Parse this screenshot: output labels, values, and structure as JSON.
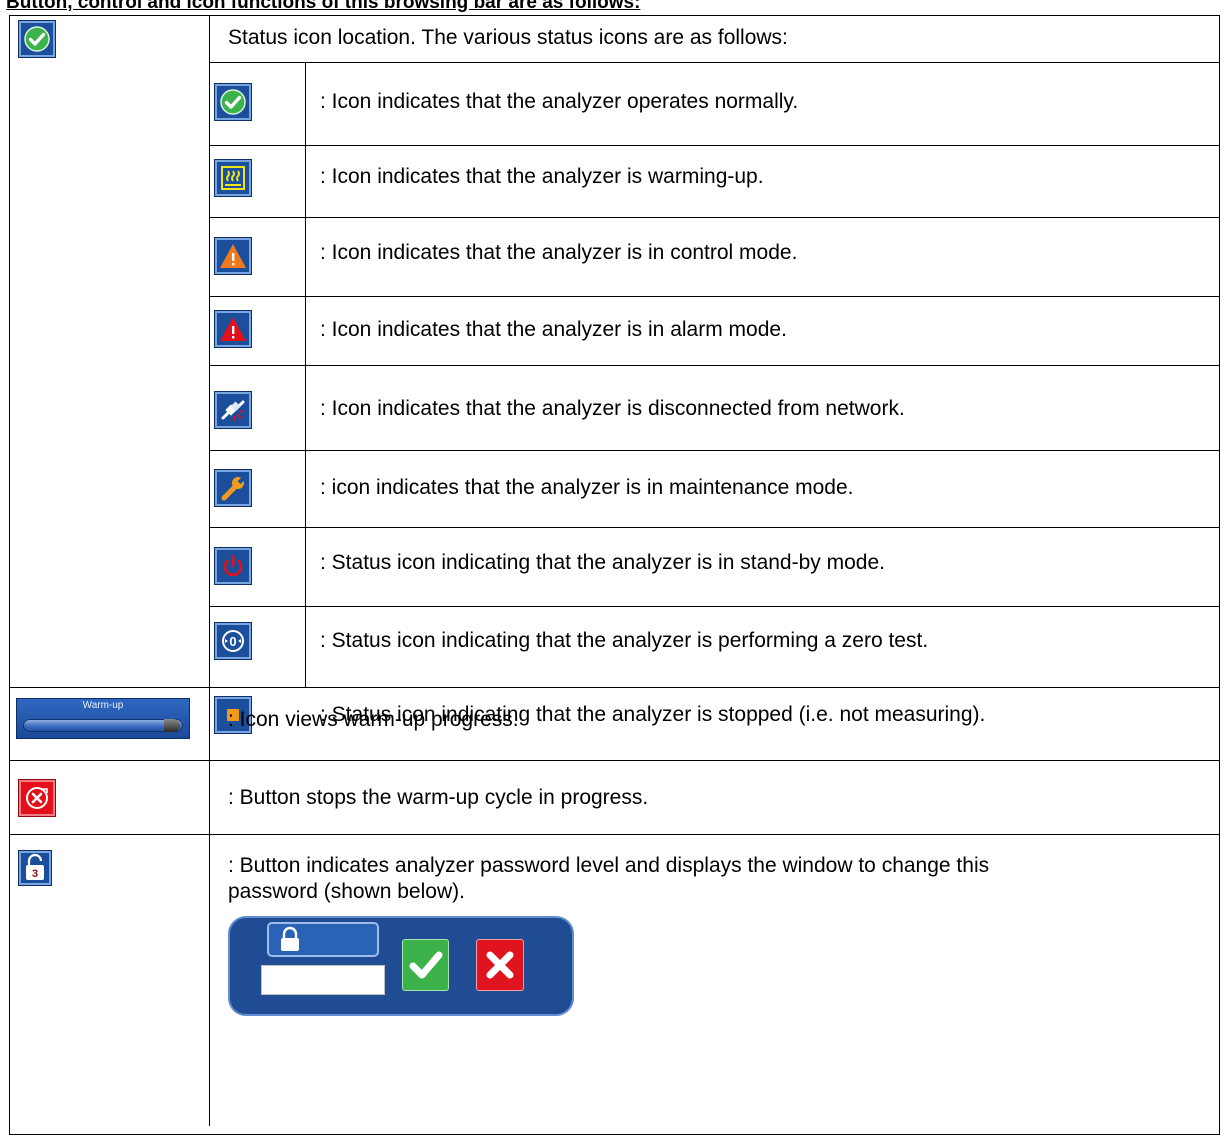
{
  "heading": "Button, control and icon functions of this browsing bar are as follows:",
  "status_intro": "Status icon location. The various status icons are as follows:",
  "status_rows": [
    {
      "icon": "check-circle-icon",
      "text": ": Icon indicates that the analyzer operates normally."
    },
    {
      "icon": "heat-waves-icon",
      "text": ": Icon indicates that the analyzer is warming-up."
    },
    {
      "icon": "orange-warning-triangle-icon",
      "text": ": Icon indicates that the analyzer is in control mode."
    },
    {
      "icon": "red-warning-triangle-icon",
      "text": ": Icon indicates that the analyzer is in alarm mode."
    },
    {
      "icon": "disconnected-plug-icon",
      "text": ": Icon indicates that the analyzer is disconnected from network."
    },
    {
      "icon": "wrench-icon",
      "text": ": icon indicates that the analyzer is in maintenance mode."
    },
    {
      "icon": "power-icon",
      "text": ": Status icon indicating that the analyzer is in stand-by mode."
    },
    {
      "icon": "zero-test-icon",
      "text": ": Status icon indicating that the analyzer is performing a zero test."
    },
    {
      "icon": "stop-square-icon",
      "text": ": Status icon indicating that the analyzer is stopped (i.e. not measuring)."
    }
  ],
  "warmup": {
    "label": "Warm-up",
    "text": ": Icon views warm-up progress.",
    "progress_fraction": 0.88,
    "colors": {
      "track": "#3c6bc0",
      "end": "#2a2a2a"
    }
  },
  "stop_warmup": {
    "icon": "stop-cycle-icon",
    "text": ": Button stops the warm-up cycle in progress."
  },
  "password": {
    "icon": "unlocked-padlock-icon",
    "level": "3",
    "text_line1": ": Button indicates analyzer password level and displays the window to change this",
    "text_line2": "password (shown below)."
  },
  "colors": {
    "tile_blue": "#1b4f9c",
    "ok_green": "#3bb34a",
    "alarm_red": "#e3101b",
    "warn_orange": "#f07a1a",
    "warm_yellow": "#f2e21a"
  }
}
